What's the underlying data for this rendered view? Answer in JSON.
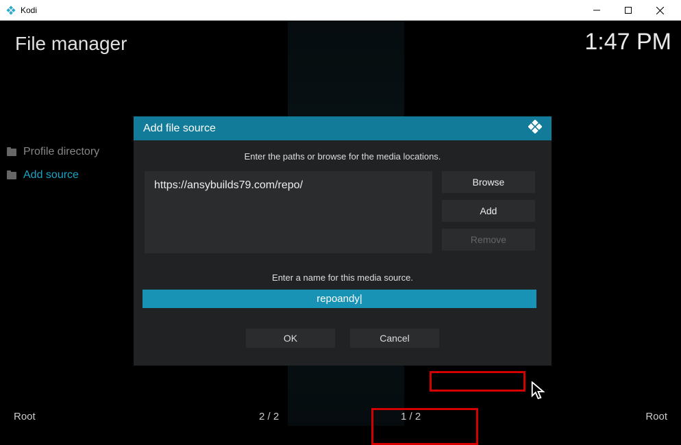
{
  "window": {
    "title": "Kodi"
  },
  "header": {
    "page_title": "File manager",
    "clock": "1:47 PM"
  },
  "left": {
    "items": [
      {
        "label": "Profile directory",
        "highlighted": false
      },
      {
        "label": "Add source",
        "highlighted": true
      }
    ]
  },
  "dialog": {
    "title": "Add file source",
    "instruction_paths": "Enter the paths or browse for the media locations.",
    "path_value": "https://ansybuilds79.com/repo/",
    "buttons": {
      "browse": "Browse",
      "add": "Add",
      "remove": "Remove"
    },
    "instruction_name": "Enter a name for this media source.",
    "name_value": "repoandy|",
    "ok": "OK",
    "cancel": "Cancel"
  },
  "status": {
    "left_root": "Root",
    "left_count": "2 / 2",
    "right_count": "1 / 2",
    "right_root": "Root"
  }
}
